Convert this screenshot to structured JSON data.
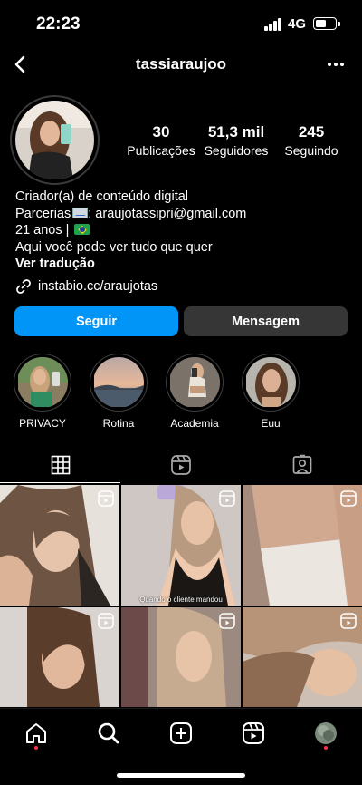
{
  "status_bar": {
    "time": "22:23",
    "network": "4G",
    "battery_level_pct": 55
  },
  "header": {
    "username": "tassiaraujoo",
    "back_icon": "chevron-left-icon",
    "more_icon": "more-horizontal-icon"
  },
  "profile": {
    "stats": {
      "posts": {
        "value": "30",
        "label": "Publicações"
      },
      "followers": {
        "value": "51,3 mil",
        "label": "Seguidores"
      },
      "following": {
        "value": "245",
        "label": "Seguindo"
      }
    },
    "bio": {
      "category": "Criador(a) de conteúdo digital",
      "partnerships_prefix": "Parcerias",
      "partnerships_email": ": araujotassipri@gmail.com",
      "age": "21 anos | ",
      "tagline": "Aqui você pode ver tudo que quer",
      "see_translation": "Ver tradução",
      "link": "instabio.cc/araujotas"
    }
  },
  "actions": {
    "follow": "Seguir",
    "message": "Mensagem"
  },
  "highlights": [
    {
      "label": "PRIVACY"
    },
    {
      "label": "Rotina"
    },
    {
      "label": "Academia"
    },
    {
      "label": "Euu"
    }
  ],
  "tabs": [
    "grid-icon",
    "reels-icon",
    "tagged-icon"
  ],
  "grid_posts": [
    {
      "type": "reel",
      "caption": ""
    },
    {
      "type": "reel",
      "caption": "Quando o cliente mandou"
    },
    {
      "type": "reel",
      "caption": ""
    },
    {
      "type": "reel",
      "caption": ""
    },
    {
      "type": "reel",
      "caption": ""
    },
    {
      "type": "reel",
      "caption": ""
    }
  ],
  "bottom_nav": [
    "home-icon",
    "search-icon",
    "create-icon",
    "reels-icon",
    "profile-avatar"
  ],
  "colors": {
    "background": "#000000",
    "follow_button": "#0095f6",
    "message_button": "#363636",
    "notification_dot": "#ff3040"
  }
}
